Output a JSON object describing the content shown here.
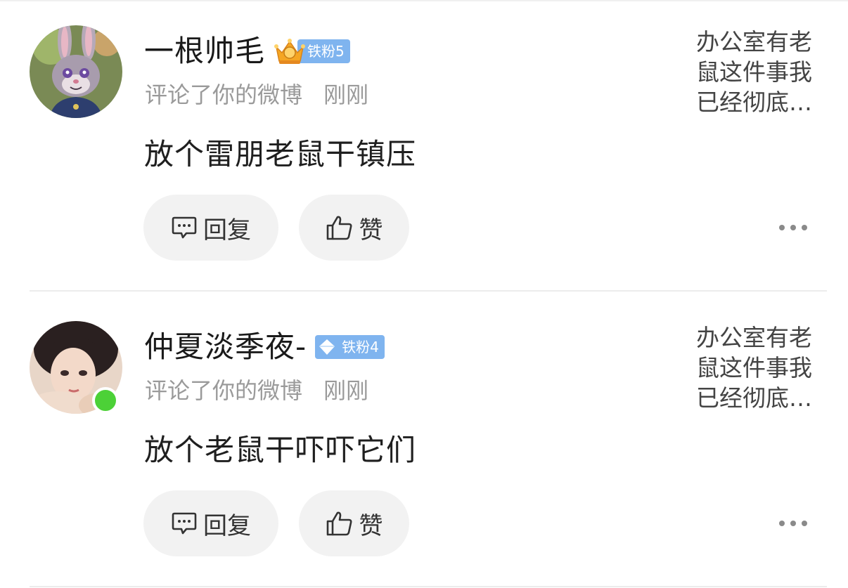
{
  "notifications": [
    {
      "username": "一根帅毛",
      "fan_badge": "铁粉5",
      "action": "评论了你的微博",
      "time": "刚刚",
      "comment": "放个雷朋老鼠干镇压",
      "quoted_post": "办公室有老鼠这件事我已经彻底…",
      "reply_label": "回复",
      "like_label": "赞",
      "online": false
    },
    {
      "username": "仲夏淡季夜-",
      "fan_badge": "铁粉4",
      "action": "评论了你的微博",
      "time": "刚刚",
      "comment": "放个老鼠干吓吓它们",
      "quoted_post": "办公室有老鼠这件事我已经彻底…",
      "reply_label": "回复",
      "like_label": "赞",
      "online": true
    }
  ],
  "colors": {
    "badge_blue": "#7fb4ef",
    "online_green": "#4cd137",
    "button_bg": "#f2f2f2",
    "meta_gray": "#9a9a9a"
  }
}
